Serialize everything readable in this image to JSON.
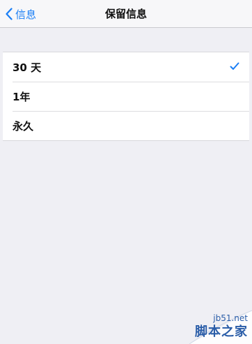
{
  "navbar": {
    "back_label": "信息",
    "title": "保留信息"
  },
  "options": [
    {
      "label": "30 天",
      "selected": true
    },
    {
      "label": "1年",
      "selected": false
    },
    {
      "label": "永久",
      "selected": false
    }
  ],
  "colors": {
    "accent": "#1a7ef5",
    "background": "#efeff4"
  },
  "watermark": {
    "url": "jb51.net",
    "text": "脚本之家"
  }
}
